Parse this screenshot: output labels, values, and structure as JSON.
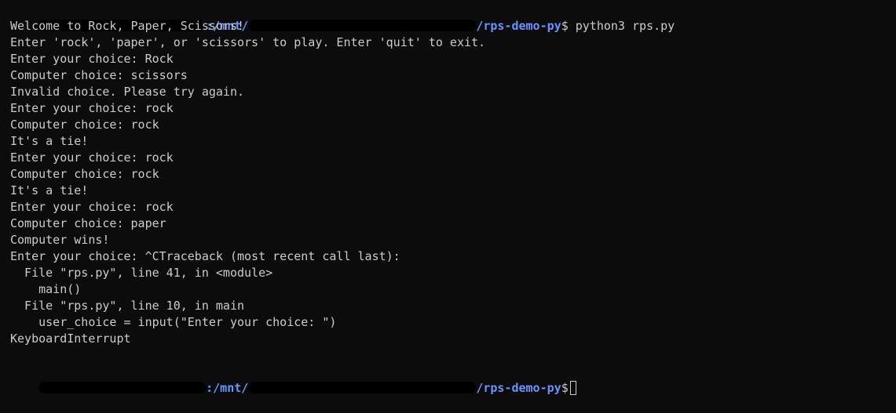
{
  "terminal": {
    "prompt": {
      "path_prefix": ":/mnt/",
      "path_suffix": "/rps-demo-py",
      "symbol": "$",
      "command": " python3 rps.py"
    },
    "lines": [
      "Welcome to Rock, Paper, Scissors!",
      "Enter 'rock', 'paper', or 'scissors' to play. Enter 'quit' to exit.",
      "Enter your choice: Rock",
      "Computer choice: scissors",
      "Invalid choice. Please try again.",
      "Enter your choice: rock",
      "Computer choice: rock",
      "It's a tie!",
      "Enter your choice: rock",
      "Computer choice: rock",
      "It's a tie!",
      "Enter your choice: rock",
      "Computer choice: paper",
      "Computer wins!",
      "Enter your choice: ^CTraceback (most recent call last):",
      "  File \"rps.py\", line 41, in <module>",
      "    main()",
      "  File \"rps.py\", line 10, in main",
      "    user_choice = input(\"Enter your choice: \")",
      "KeyboardInterrupt"
    ],
    "final_prompt": {
      "path_prefix": ":/mnt/",
      "path_suffix": "/rps-demo-py",
      "symbol": "$"
    },
    "colors": {
      "background": "#0c0c0c",
      "text": "#cccccc",
      "path": "#6a93ff",
      "user": "#3fb950"
    }
  }
}
